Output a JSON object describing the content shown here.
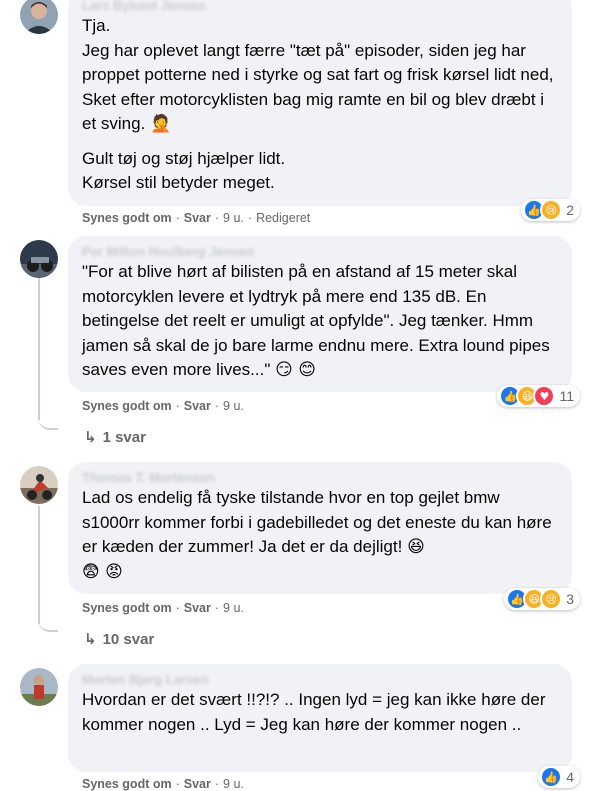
{
  "comments": [
    {
      "author": "Lars Bylund Jensen",
      "paragraphs": [
        "Tja.\nJeg har oplevet langt færre \"tæt på\" episoder, siden jeg har proppet potterne ned i styrke og sat fart og frisk kørsel lidt ned, Sket efter motorcyklisten bag mig ramte en bil og blev dræbt i et sving.",
        "Gult tøj og støj hjælper lidt.\nKørsel stil betyder meget."
      ],
      "emoji_inline": "🤦",
      "like_label": "Synes godt om",
      "reply_label": "Svar",
      "time": "9 u.",
      "edited": "Redigeret",
      "reaction_count": "2"
    },
    {
      "author": "Per Milton Houlberg Jensen",
      "text": "\"For at blive hørt af bilisten på en afstand af 15 meter skal motorcyklen levere et lydtryk på mere end 135 dB. En betingelse det reelt er umuligt at opfylde\". Jeg tænker. Hmm jamen så skal de jo bare larme endnu mere. Extra lound pipes saves even more lives...\"",
      "emoji_inline": "😏 😊",
      "like_label": "Synes godt om",
      "reply_label": "Svar",
      "time": "9 u.",
      "reaction_count": "11",
      "replies_label": "1 svar"
    },
    {
      "author": "Thomas T. Mortensen",
      "text": "Lad os endelig få tyske tilstande hvor en top gejlet bmw s1000rr kommer forbi i gadebilledet og det eneste du kan høre er kæden der zummer! Ja det er da dejligt!",
      "emoji_inline": "😆",
      "emoji_line2": "😨 😡",
      "like_label": "Synes godt om",
      "reply_label": "Svar",
      "time": "9 u.",
      "reaction_count": "3",
      "replies_label": "10 svar"
    },
    {
      "author": "Morten Bjerg Larsen",
      "text": "Hvordan er det svært !!?!? .. Ingen lyd = jeg kan ikke høre der kommer nogen .. Lyd = Jeg kan høre der kommer nogen ..",
      "like_label": "Synes godt om",
      "reply_label": "Svar",
      "time": "9 u.",
      "reaction_count": "4"
    }
  ],
  "colors": {
    "bubble": "#f0f2f5",
    "secondary_text": "#65676b",
    "like_blue": "#1877f2",
    "love_red": "#f33e58",
    "emoji_yellow": "#f7b125"
  }
}
